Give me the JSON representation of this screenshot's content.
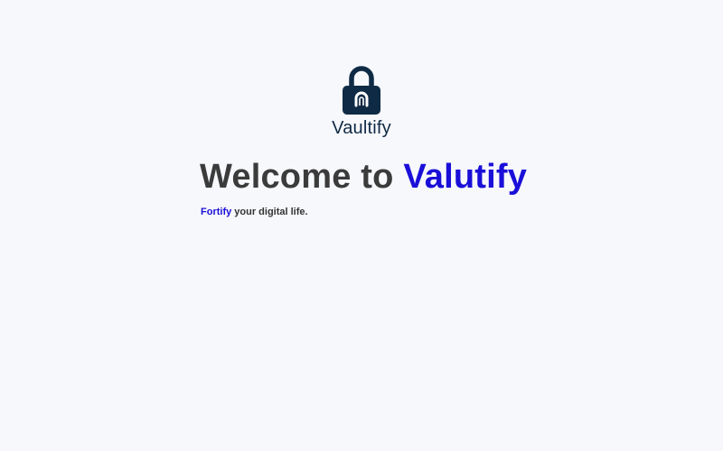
{
  "brand": {
    "name": "Vaultify",
    "icon": "lock-icon",
    "color": "#0f2a44"
  },
  "hero": {
    "headline_prefix": "Welcome to ",
    "headline_accent": "Valutify",
    "tagline_accent": "Fortify",
    "tagline_rest": " your digital life."
  },
  "colors": {
    "background": "#f7f8fc",
    "accent": "#1a0fd8",
    "text": "#3b3b3b"
  }
}
